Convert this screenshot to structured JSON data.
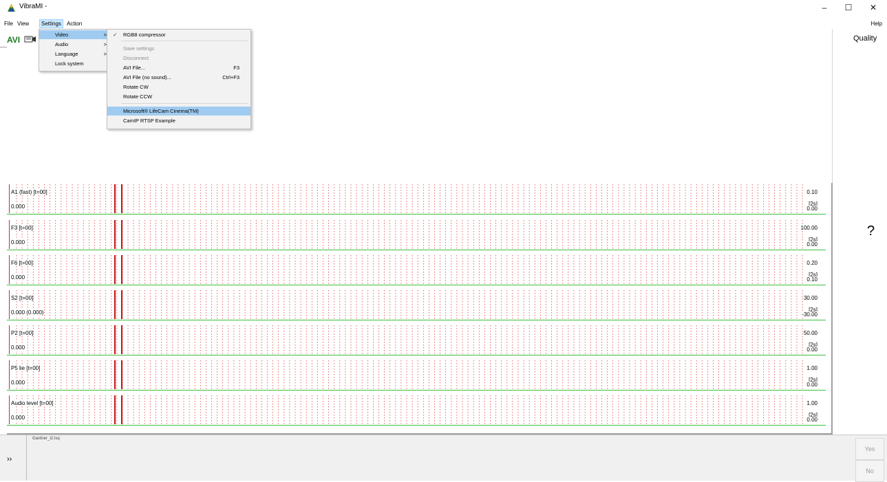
{
  "window": {
    "title": "VibraMI -",
    "minimize": "–",
    "maximize": "☐",
    "close": "✕"
  },
  "menubar": {
    "items": [
      "File",
      "View",
      "Settings",
      "Action"
    ],
    "help": "Help"
  },
  "toolbar": {
    "avi_label": "AVI"
  },
  "right_panel": {
    "quality": "Quality",
    "indicator": "?"
  },
  "settings_menu": {
    "items": [
      {
        "label": "Video",
        "arrow": ">"
      },
      {
        "label": "Audio",
        "arrow": ">"
      },
      {
        "label": "Language",
        "arrow": ">"
      },
      {
        "label": "Lock system",
        "arrow": ""
      }
    ]
  },
  "video_submenu": {
    "compressor": {
      "label": "RGB8 compressor",
      "check": "✓"
    },
    "save_settings": "Save settings",
    "disconnect": "Disconnect",
    "avi_file": {
      "label": "AVI File...",
      "shortcut": "F3"
    },
    "avi_file_no_sound": {
      "label": "AVI File (no sound)...",
      "shortcut": "Ctrl+F3"
    },
    "rotate_cw": "Rotate CW",
    "rotate_ccw": "Rotate CCW",
    "device_lifecam": "Microsoft® LifeCam Cinema(TM)",
    "device_camip": "CamIP RTSP Example"
  },
  "channels": [
    {
      "name": "A1 (fast) [t=00]",
      "value": "0.000",
      "max": "0.10",
      "span": "[2s]",
      "min": "0.00"
    },
    {
      "name": "F3 [t=00]",
      "value": "0.000",
      "max": "100.00",
      "span": "[2s]",
      "min": "0.00"
    },
    {
      "name": "F6 [t=00]",
      "value": "0.000",
      "max": "0.20",
      "span": "[2s]",
      "min": "0.10"
    },
    {
      "name": "S2 [t=00]",
      "value": "0.000 (0.000)",
      "max": "30.00",
      "span": "[2s]",
      "min": "-30.00"
    },
    {
      "name": "P2 [t=00]",
      "value": "0.000",
      "max": "50.00",
      "span": "[2s]",
      "min": "0.00"
    },
    {
      "name": "P5 lie [t=00]",
      "value": "0.000",
      "max": "1.00",
      "span": "[2s]",
      "min": "0.00"
    },
    {
      "name": "Audio level [t=00]",
      "value": "0.000",
      "max": "1.00",
      "span": "[2s]",
      "min": "0.00"
    }
  ],
  "bottom": {
    "expander": "››",
    "filename": "Gardner_t2.lsq",
    "yes": "Yes",
    "no": "No"
  },
  "colors": {
    "accent_green": "#1e7a1e",
    "grid_red": "#e02020",
    "baseline_green": "#3bbf3b",
    "highlight": "#9fcbf0"
  }
}
